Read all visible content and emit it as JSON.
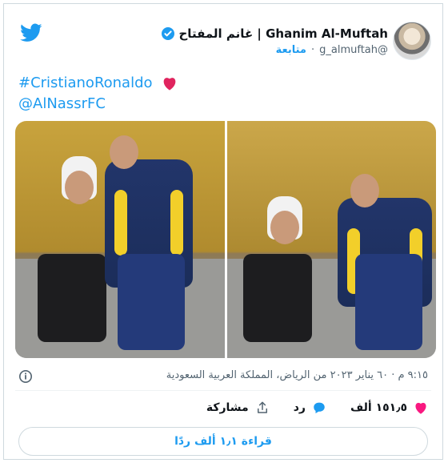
{
  "header": {
    "display_name": "Ghanim Al-Muftah | غانم المفتاح",
    "handle": "@g_almuftah",
    "follow_label": "متابعة"
  },
  "tweet": {
    "line1": "#CristianoRonaldo",
    "line2": "@AlNassrFC"
  },
  "meta": {
    "timestamp": "٩:١٥ م · ٦٠ يناير ٢٠٢٣ من الرياض، المملكة العربية السعودية"
  },
  "actions": {
    "likes": "١٥١٫٥ ألف",
    "reply_label": "رد",
    "share_label": "مشاركة"
  },
  "replies": {
    "button_label": "قراءة ١٫١ ألف ردًا"
  },
  "colors": {
    "accent": "#1d9bf0",
    "heart": "#f91880",
    "text_muted": "#536471"
  },
  "icons": [
    "twitter-bird-icon",
    "verified-icon",
    "heart-icon",
    "info-icon",
    "reply-icon",
    "share-icon"
  ]
}
